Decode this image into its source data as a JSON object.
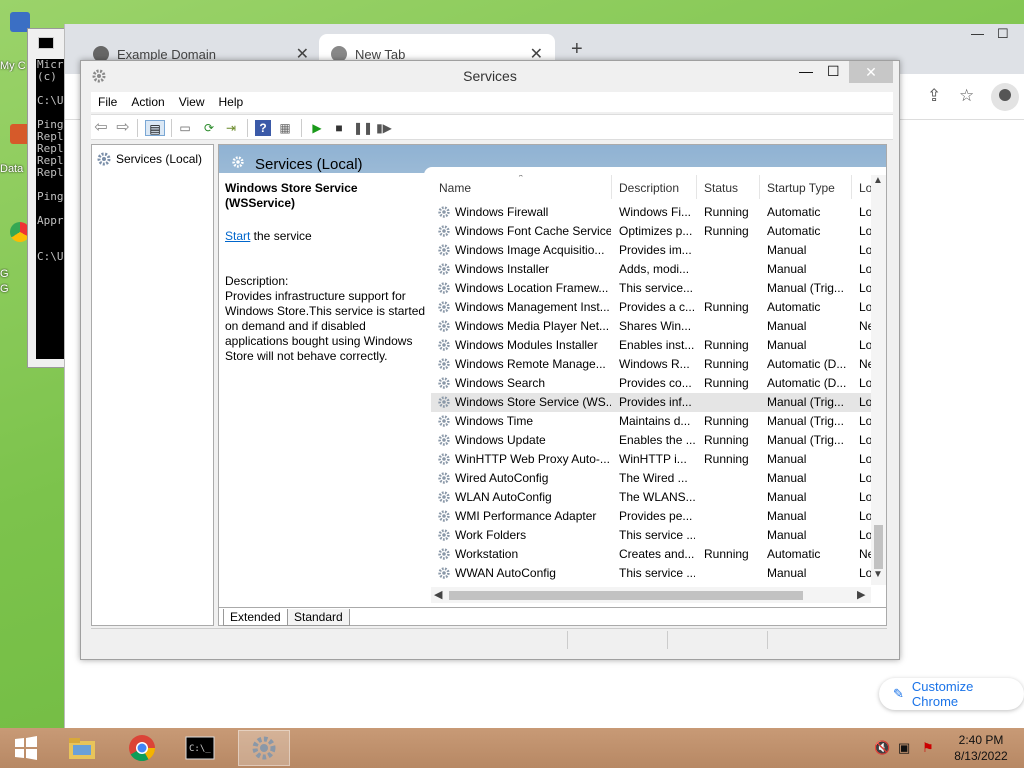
{
  "desktop": {
    "icons": [
      {
        "label": "My C"
      },
      {
        "label": "Data"
      },
      {
        "label": "G"
      },
      {
        "label": "G"
      }
    ]
  },
  "cmd": {
    "lines": [
      "Micr",
      "(c)",
      "",
      "C:\\U",
      "",
      "Ping",
      "Repl",
      "Repl",
      "Repl",
      "Repl",
      "",
      "Ping",
      "",
      "Appr",
      "",
      "",
      "C:\\U"
    ]
  },
  "chrome": {
    "tabs": [
      {
        "title": "Example Domain"
      },
      {
        "title": "New Tab"
      }
    ],
    "customize_label": "Customize Chrome"
  },
  "services": {
    "window_title": "Services",
    "menu": [
      "File",
      "Action",
      "View",
      "Help"
    ],
    "tree_root": "Services (Local)",
    "header_title": "Services (Local)",
    "selected_service_title": "Windows Store Service (WSService)",
    "start_link": "Start",
    "start_suffix": " the service",
    "description_label": "Description:",
    "description_text": "Provides infrastructure support for Windows Store.This service is started on demand and if disabled applications bought using Windows Store will not behave correctly.",
    "columns": [
      "Name",
      "Description",
      "Status",
      "Startup Type",
      "Lo"
    ],
    "rows": [
      {
        "name": "Windows Firewall",
        "description": "Windows Fi...",
        "status": "Running",
        "startup": "Automatic",
        "logon": "Lo"
      },
      {
        "name": "Windows Font Cache Service",
        "description": "Optimizes p...",
        "status": "Running",
        "startup": "Automatic",
        "logon": "Lo"
      },
      {
        "name": "Windows Image Acquisitio...",
        "description": "Provides im...",
        "status": "",
        "startup": "Manual",
        "logon": "Lo"
      },
      {
        "name": "Windows Installer",
        "description": "Adds, modi...",
        "status": "",
        "startup": "Manual",
        "logon": "Lo"
      },
      {
        "name": "Windows Location Framew...",
        "description": "This service...",
        "status": "",
        "startup": "Manual (Trig...",
        "logon": "Lo"
      },
      {
        "name": "Windows Management Inst...",
        "description": "Provides a c...",
        "status": "Running",
        "startup": "Automatic",
        "logon": "Lo"
      },
      {
        "name": "Windows Media Player Net...",
        "description": "Shares Win...",
        "status": "",
        "startup": "Manual",
        "logon": "Ne"
      },
      {
        "name": "Windows Modules Installer",
        "description": "Enables inst...",
        "status": "Running",
        "startup": "Manual",
        "logon": "Lo"
      },
      {
        "name": "Windows Remote Manage...",
        "description": "Windows R...",
        "status": "Running",
        "startup": "Automatic (D...",
        "logon": "Ne"
      },
      {
        "name": "Windows Search",
        "description": "Provides co...",
        "status": "Running",
        "startup": "Automatic (D...",
        "logon": "Lo"
      },
      {
        "name": "Windows Store Service (WS...",
        "description": "Provides inf...",
        "status": "",
        "startup": "Manual (Trig...",
        "logon": "Lo",
        "selected": true
      },
      {
        "name": "Windows Time",
        "description": "Maintains d...",
        "status": "Running",
        "startup": "Manual (Trig...",
        "logon": "Lo"
      },
      {
        "name": "Windows Update",
        "description": "Enables the ...",
        "status": "Running",
        "startup": "Manual (Trig...",
        "logon": "Lo"
      },
      {
        "name": "WinHTTP Web Proxy Auto-...",
        "description": "WinHTTP i...",
        "status": "Running",
        "startup": "Manual",
        "logon": "Lo"
      },
      {
        "name": "Wired AutoConfig",
        "description": "The Wired ...",
        "status": "",
        "startup": "Manual",
        "logon": "Lo"
      },
      {
        "name": "WLAN AutoConfig",
        "description": "The WLANS...",
        "status": "",
        "startup": "Manual",
        "logon": "Lo"
      },
      {
        "name": "WMI Performance Adapter",
        "description": "Provides pe...",
        "status": "",
        "startup": "Manual",
        "logon": "Lo"
      },
      {
        "name": "Work Folders",
        "description": "This service ...",
        "status": "",
        "startup": "Manual",
        "logon": "Lo"
      },
      {
        "name": "Workstation",
        "description": "Creates and...",
        "status": "Running",
        "startup": "Automatic",
        "logon": "Ne"
      },
      {
        "name": "WWAN AutoConfig",
        "description": "This service ...",
        "status": "",
        "startup": "Manual",
        "logon": "Lo"
      }
    ],
    "bottom_tabs": [
      "Extended",
      "Standard"
    ]
  },
  "taskbar": {
    "time": "2:40 PM",
    "date": "8/13/2022"
  },
  "colors": {
    "desktop_green": "#7cc34c",
    "taskbar": "#c09070",
    "pane_header": "#8fb2d3",
    "link": "#0066cc",
    "chrome_accent": "#1a73e8"
  }
}
